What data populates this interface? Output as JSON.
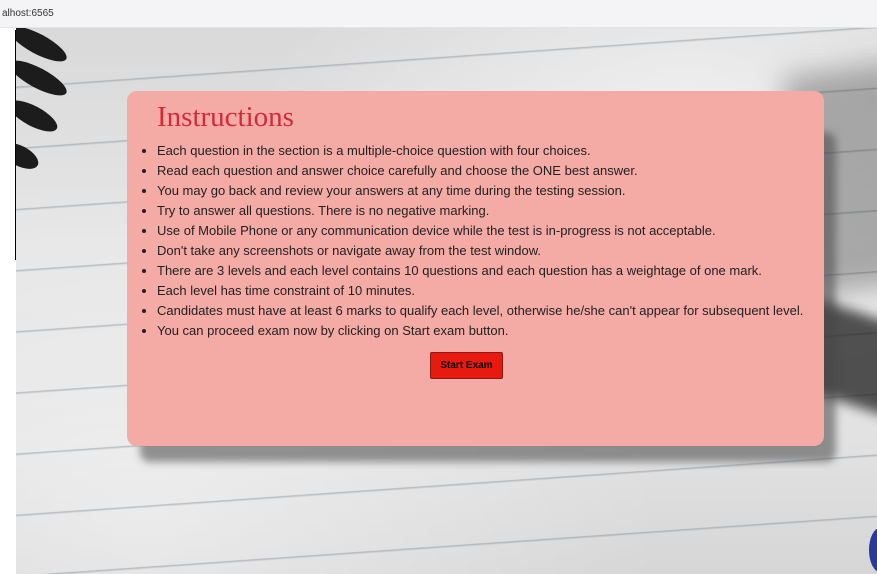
{
  "browser": {
    "url": "alhost:6565"
  },
  "instructions": {
    "title": "Instructions",
    "items": [
      "Each question in the section is a multiple-choice question with four choices.",
      "Read each question and answer choice carefully and choose the ONE best answer.",
      "You may go back and review your answers at any time during the testing session.",
      "Try to answer all questions. There is no negative marking.",
      "Use of Mobile Phone or any communication device while the test is in-progress is not acceptable.",
      "Don't take any screenshots or navigate away from the test window.",
      "There are 3 levels and each level contains 10 questions and each question has a weightage of one mark.",
      "Each level has time constraint of 10 minutes.",
      "Candidates must have at least 6 marks to qualify each level, otherwise he/she can't appear for subsequent level.",
      "You can proceed exam now by clicking on Start exam button."
    ],
    "start_button_label": "Start Exam"
  },
  "colors": {
    "card_background": "#f4aaa5",
    "title": "#d12b38",
    "start_button": "#e8190f"
  }
}
